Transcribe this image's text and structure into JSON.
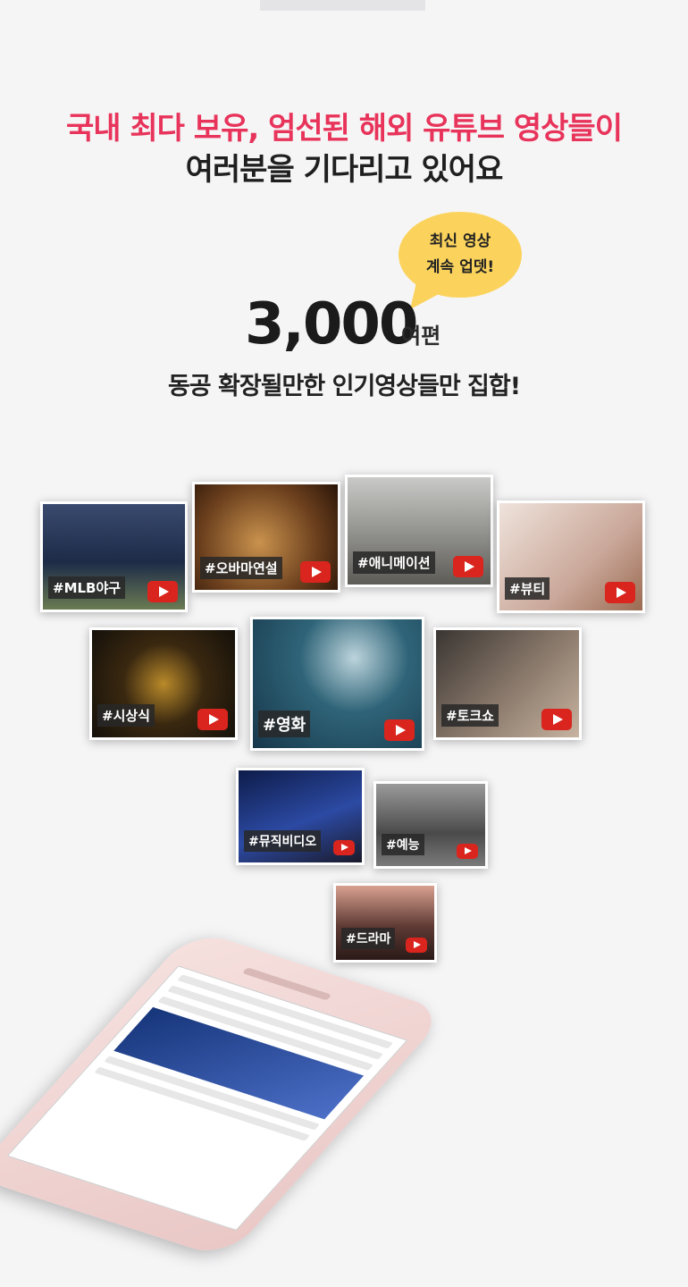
{
  "headline": {
    "line1": "국내 최다 보유, 엄선된 해외 유튜브 영상들이",
    "line2": "여러분을 기다리고 있어요"
  },
  "bubble": {
    "line1": "최신 영상",
    "line2": "계속 업뎃!"
  },
  "count": {
    "value": "3,000",
    "suffix": "여편"
  },
  "subline": "동공 확장될만한 인기영상들만 집합!",
  "cards": [
    {
      "tag": "#MLB야구",
      "bg": "#2c3f63"
    },
    {
      "tag": "#오바마연설",
      "bg": "#8a5a2e"
    },
    {
      "tag": "#애니메이션",
      "bg": "#8b8b86"
    },
    {
      "tag": "#뷰티",
      "bg": "#d9c2b8"
    },
    {
      "tag": "#시상식",
      "bg": "#2a1f14"
    },
    {
      "tag": "#영화",
      "bg": "#1f4a63"
    },
    {
      "tag": "#토크쇼",
      "bg": "#6a5c52"
    },
    {
      "tag": "#뮤직비디오",
      "bg": "#1b2f6b"
    },
    {
      "tag": "#예능",
      "bg": "#6d6d6d"
    },
    {
      "tag": "#드라마",
      "bg": "#5a3a36"
    }
  ],
  "colors": {
    "accent": "#e8335a",
    "bubble": "#fbd35c",
    "play": "#d9251d"
  }
}
